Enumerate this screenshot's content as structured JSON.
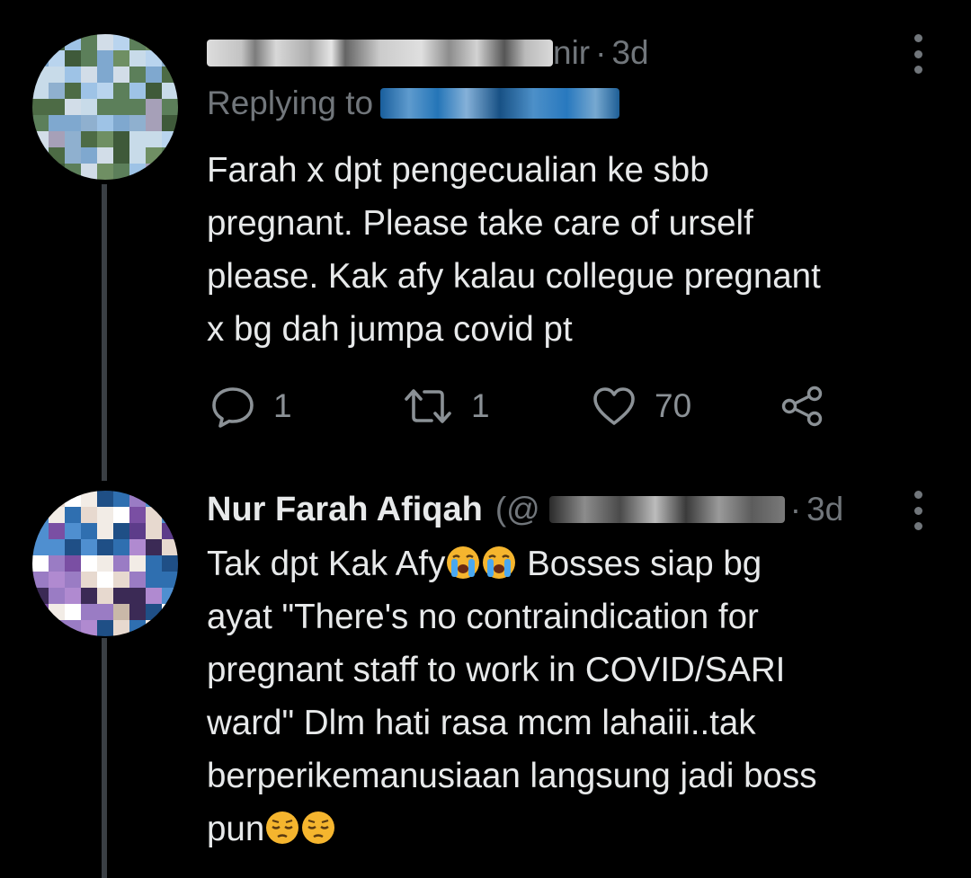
{
  "tweets": [
    {
      "name_visible_suffix": "nir",
      "time": "3d",
      "replying_to_label": "Replying to",
      "text": "Farah x dpt pengecualian ke sbb\npregnant. Please take care of urself\nplease. Kak afy kalau collegue pregnant\nx bg dah jumpa covid pt",
      "actions": {
        "replies": "1",
        "retweets": "1",
        "likes": "70"
      }
    },
    {
      "display_name": "Nur Farah Afiqah",
      "handle_prefix": "(@",
      "time": "3d",
      "text_line1_a": "Tak dpt Kak Afy",
      "text_line1_b": " Bosses siap bg",
      "text_rest": "ayat \"There's no contraindication for\npregnant staff to work in COVID/SARI\nward\" Dlm hati rasa mcm lahaiii..tak\nberperikemanusiaan langsung jadi boss",
      "text_last": "pun"
    }
  ],
  "colors": {
    "background": "#000000",
    "text_primary": "#e7e9ea",
    "text_secondary": "#71767b",
    "thread_line": "#3a3f44"
  },
  "icons": {
    "more": "more-vertical-icon",
    "reply": "speech-bubble-icon",
    "retweet": "retweet-icon",
    "like": "heart-icon",
    "share": "share-icon",
    "emoji_cry": "loudly-crying-face-emoji",
    "emoji_pensive": "pensive-face-emoji"
  }
}
